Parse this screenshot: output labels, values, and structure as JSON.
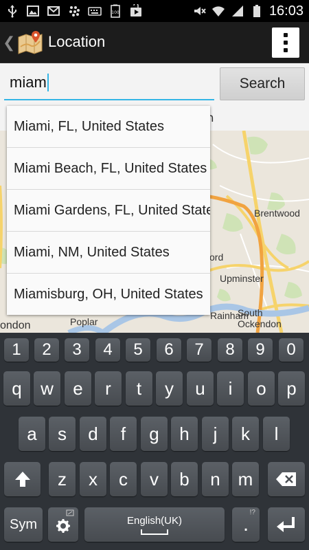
{
  "status_bar": {
    "time": "16:03",
    "left_icons": [
      "usb-icon",
      "image-icon",
      "email-icon",
      "bbm-icon",
      "keyboard-icon",
      "battery-100-icon",
      "play-store-icon"
    ],
    "right_icons": [
      "mute-icon",
      "wifi-icon",
      "signal-icon",
      "battery-icon"
    ]
  },
  "action_bar": {
    "title": "Location",
    "up_caret": "❮",
    "menu_icon": "overflow-menu-icon"
  },
  "search": {
    "input_value": "miam",
    "button_label": "Search"
  },
  "behind_text": "in",
  "suggestions": [
    "Miami, FL, United States",
    "Miami Beach, FL, United States",
    "Miami Gardens, FL, United States",
    "Miami, NM, United States",
    "Miamisburg, OH, United States"
  ],
  "map": {
    "labels": [
      "Brentwood",
      "ord",
      "Upminster",
      "Rainham",
      "South Ockendon",
      "Poplar",
      "ondon"
    ]
  },
  "keyboard": {
    "number_row": [
      "1",
      "2",
      "3",
      "4",
      "5",
      "6",
      "7",
      "8",
      "9",
      "0"
    ],
    "row1": [
      "q",
      "w",
      "e",
      "r",
      "t",
      "y",
      "u",
      "i",
      "o",
      "p"
    ],
    "row2": [
      "a",
      "s",
      "d",
      "f",
      "g",
      "h",
      "j",
      "k",
      "l"
    ],
    "row3": [
      "z",
      "x",
      "c",
      "v",
      "b",
      "n",
      "m"
    ],
    "sym_label": "Sym",
    "language_label": "English(UK)",
    "period_label": ".",
    "period_hint": "!?"
  }
}
